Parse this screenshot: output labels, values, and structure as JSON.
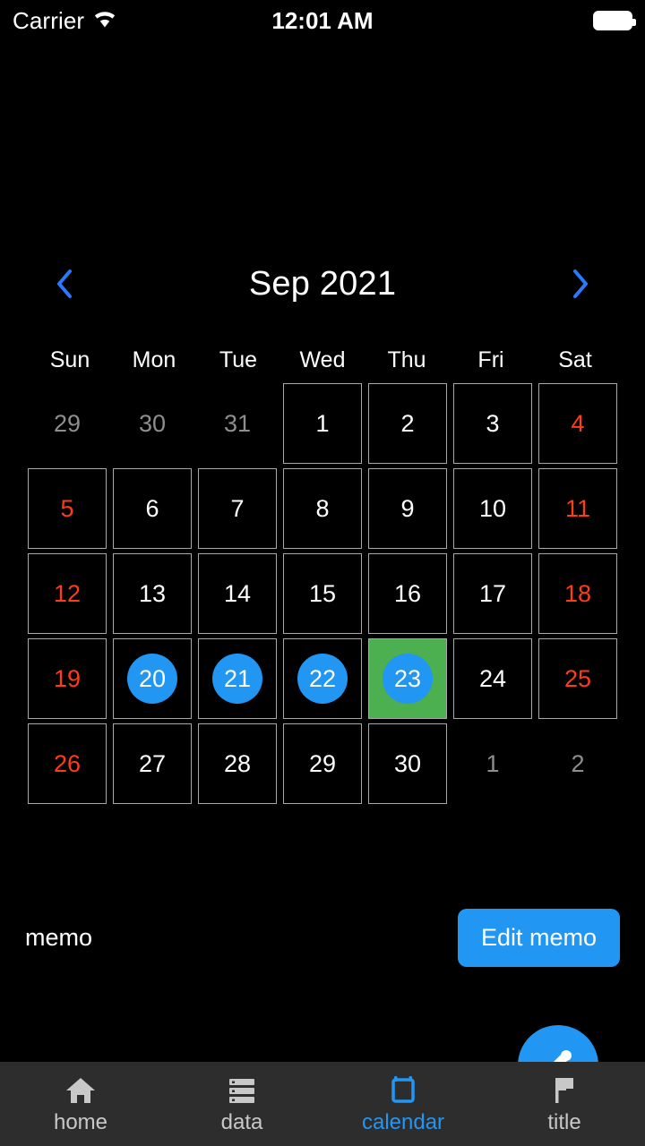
{
  "status_bar": {
    "carrier": "Carrier",
    "wifi_icon": "wifi-icon",
    "time": "12:01 AM",
    "battery_icon": "battery-icon"
  },
  "header": {
    "prev_icon": "chevron-left-icon",
    "title": "Sep 2021",
    "next_icon": "chevron-right-icon"
  },
  "colors": {
    "accent_blue": "#2196F3",
    "event_green": "#4CAF50",
    "weekend_red": "#FF3B18",
    "outside_gray": "#8E8E8E",
    "cell_border": "#A8A8A8",
    "tabbar_bg": "#2D2D2D",
    "background": "#000000"
  },
  "calendar": {
    "weekdays": [
      "Sun",
      "Mon",
      "Tue",
      "Wed",
      "Thu",
      "Fri",
      "Sat"
    ],
    "days": [
      {
        "label": "29",
        "type": "outside"
      },
      {
        "label": "30",
        "type": "outside"
      },
      {
        "label": "31",
        "type": "outside"
      },
      {
        "label": "1",
        "type": "current"
      },
      {
        "label": "2",
        "type": "current"
      },
      {
        "label": "3",
        "type": "current"
      },
      {
        "label": "4",
        "type": "current",
        "weekend": "sat"
      },
      {
        "label": "5",
        "type": "current",
        "weekend": "sun"
      },
      {
        "label": "6",
        "type": "current"
      },
      {
        "label": "7",
        "type": "current"
      },
      {
        "label": "8",
        "type": "current"
      },
      {
        "label": "9",
        "type": "current"
      },
      {
        "label": "10",
        "type": "current"
      },
      {
        "label": "11",
        "type": "current",
        "weekend": "sat"
      },
      {
        "label": "12",
        "type": "current",
        "weekend": "sun"
      },
      {
        "label": "13",
        "type": "current"
      },
      {
        "label": "14",
        "type": "current"
      },
      {
        "label": "15",
        "type": "current"
      },
      {
        "label": "16",
        "type": "current"
      },
      {
        "label": "17",
        "type": "current"
      },
      {
        "label": "18",
        "type": "current",
        "weekend": "sat"
      },
      {
        "label": "19",
        "type": "current",
        "weekend": "sun"
      },
      {
        "label": "20",
        "type": "current",
        "marked": true
      },
      {
        "label": "21",
        "type": "current",
        "marked": true
      },
      {
        "label": "22",
        "type": "current",
        "marked": true
      },
      {
        "label": "23",
        "type": "current",
        "marked": true,
        "event": true
      },
      {
        "label": "24",
        "type": "current"
      },
      {
        "label": "25",
        "type": "current",
        "weekend": "sat"
      },
      {
        "label": "26",
        "type": "current",
        "weekend": "sun"
      },
      {
        "label": "27",
        "type": "current"
      },
      {
        "label": "28",
        "type": "current"
      },
      {
        "label": "29",
        "type": "current"
      },
      {
        "label": "30",
        "type": "current"
      },
      {
        "label": "1",
        "type": "outside"
      },
      {
        "label": "2",
        "type": "outside"
      }
    ]
  },
  "memo": {
    "label": "memo",
    "button_label": "Edit memo"
  },
  "fab": {
    "icon": "pencil-icon"
  },
  "tab_bar": {
    "items": [
      {
        "label": "home",
        "icon": "home-icon",
        "active": false
      },
      {
        "label": "data",
        "icon": "database-icon",
        "active": false
      },
      {
        "label": "calendar",
        "icon": "calendar-icon",
        "active": true
      },
      {
        "label": "title",
        "icon": "flag-icon",
        "active": false
      }
    ]
  }
}
